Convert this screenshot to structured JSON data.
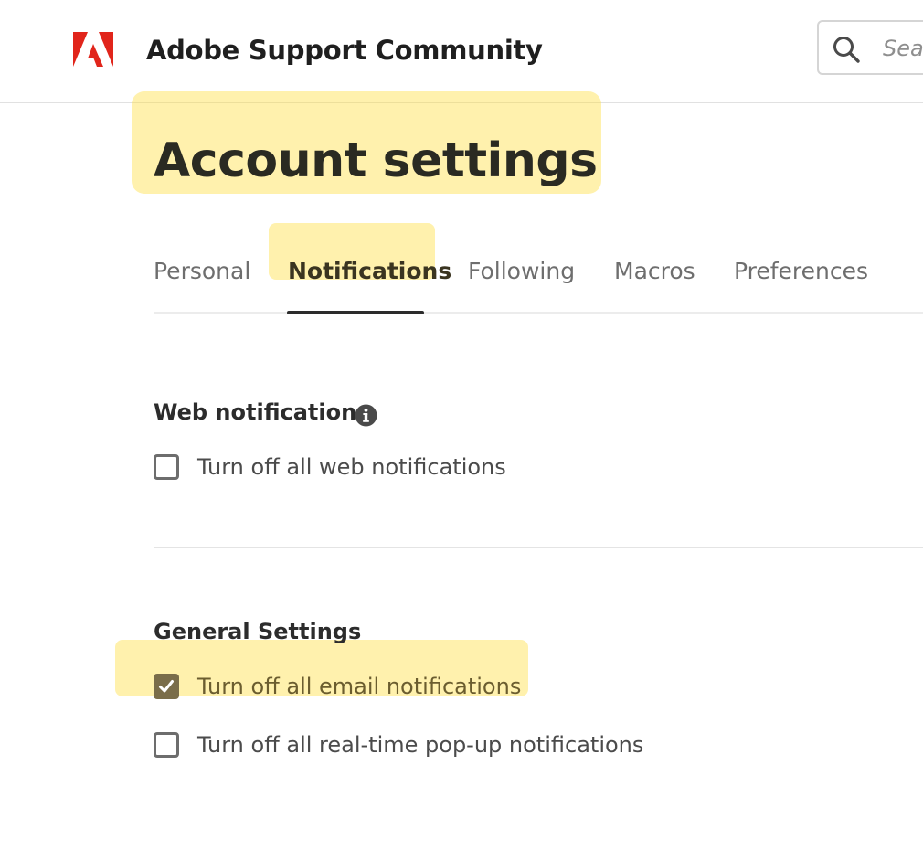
{
  "header": {
    "brand_name": "Adobe Support Community",
    "search_placeholder": "Search"
  },
  "page": {
    "title": "Account settings"
  },
  "tabs": [
    {
      "label": "Personal",
      "active": false
    },
    {
      "label": "Notifications",
      "active": true
    },
    {
      "label": "Following",
      "active": false
    },
    {
      "label": "Macros",
      "active": false
    },
    {
      "label": "Preferences",
      "active": false
    }
  ],
  "web_notifications": {
    "heading": "Web notifications",
    "options": [
      {
        "label": "Turn off all web notifications",
        "checked": false
      }
    ]
  },
  "general_settings": {
    "heading": "General Settings",
    "options": [
      {
        "label": "Turn off all email notifications",
        "checked": true
      },
      {
        "label": "Turn off all real-time pop-up notifications",
        "checked": false
      }
    ]
  },
  "colors": {
    "brand_red": "#e1251b",
    "highlighter": "#ffde3c",
    "tab_underline": "#2c2c2c"
  }
}
